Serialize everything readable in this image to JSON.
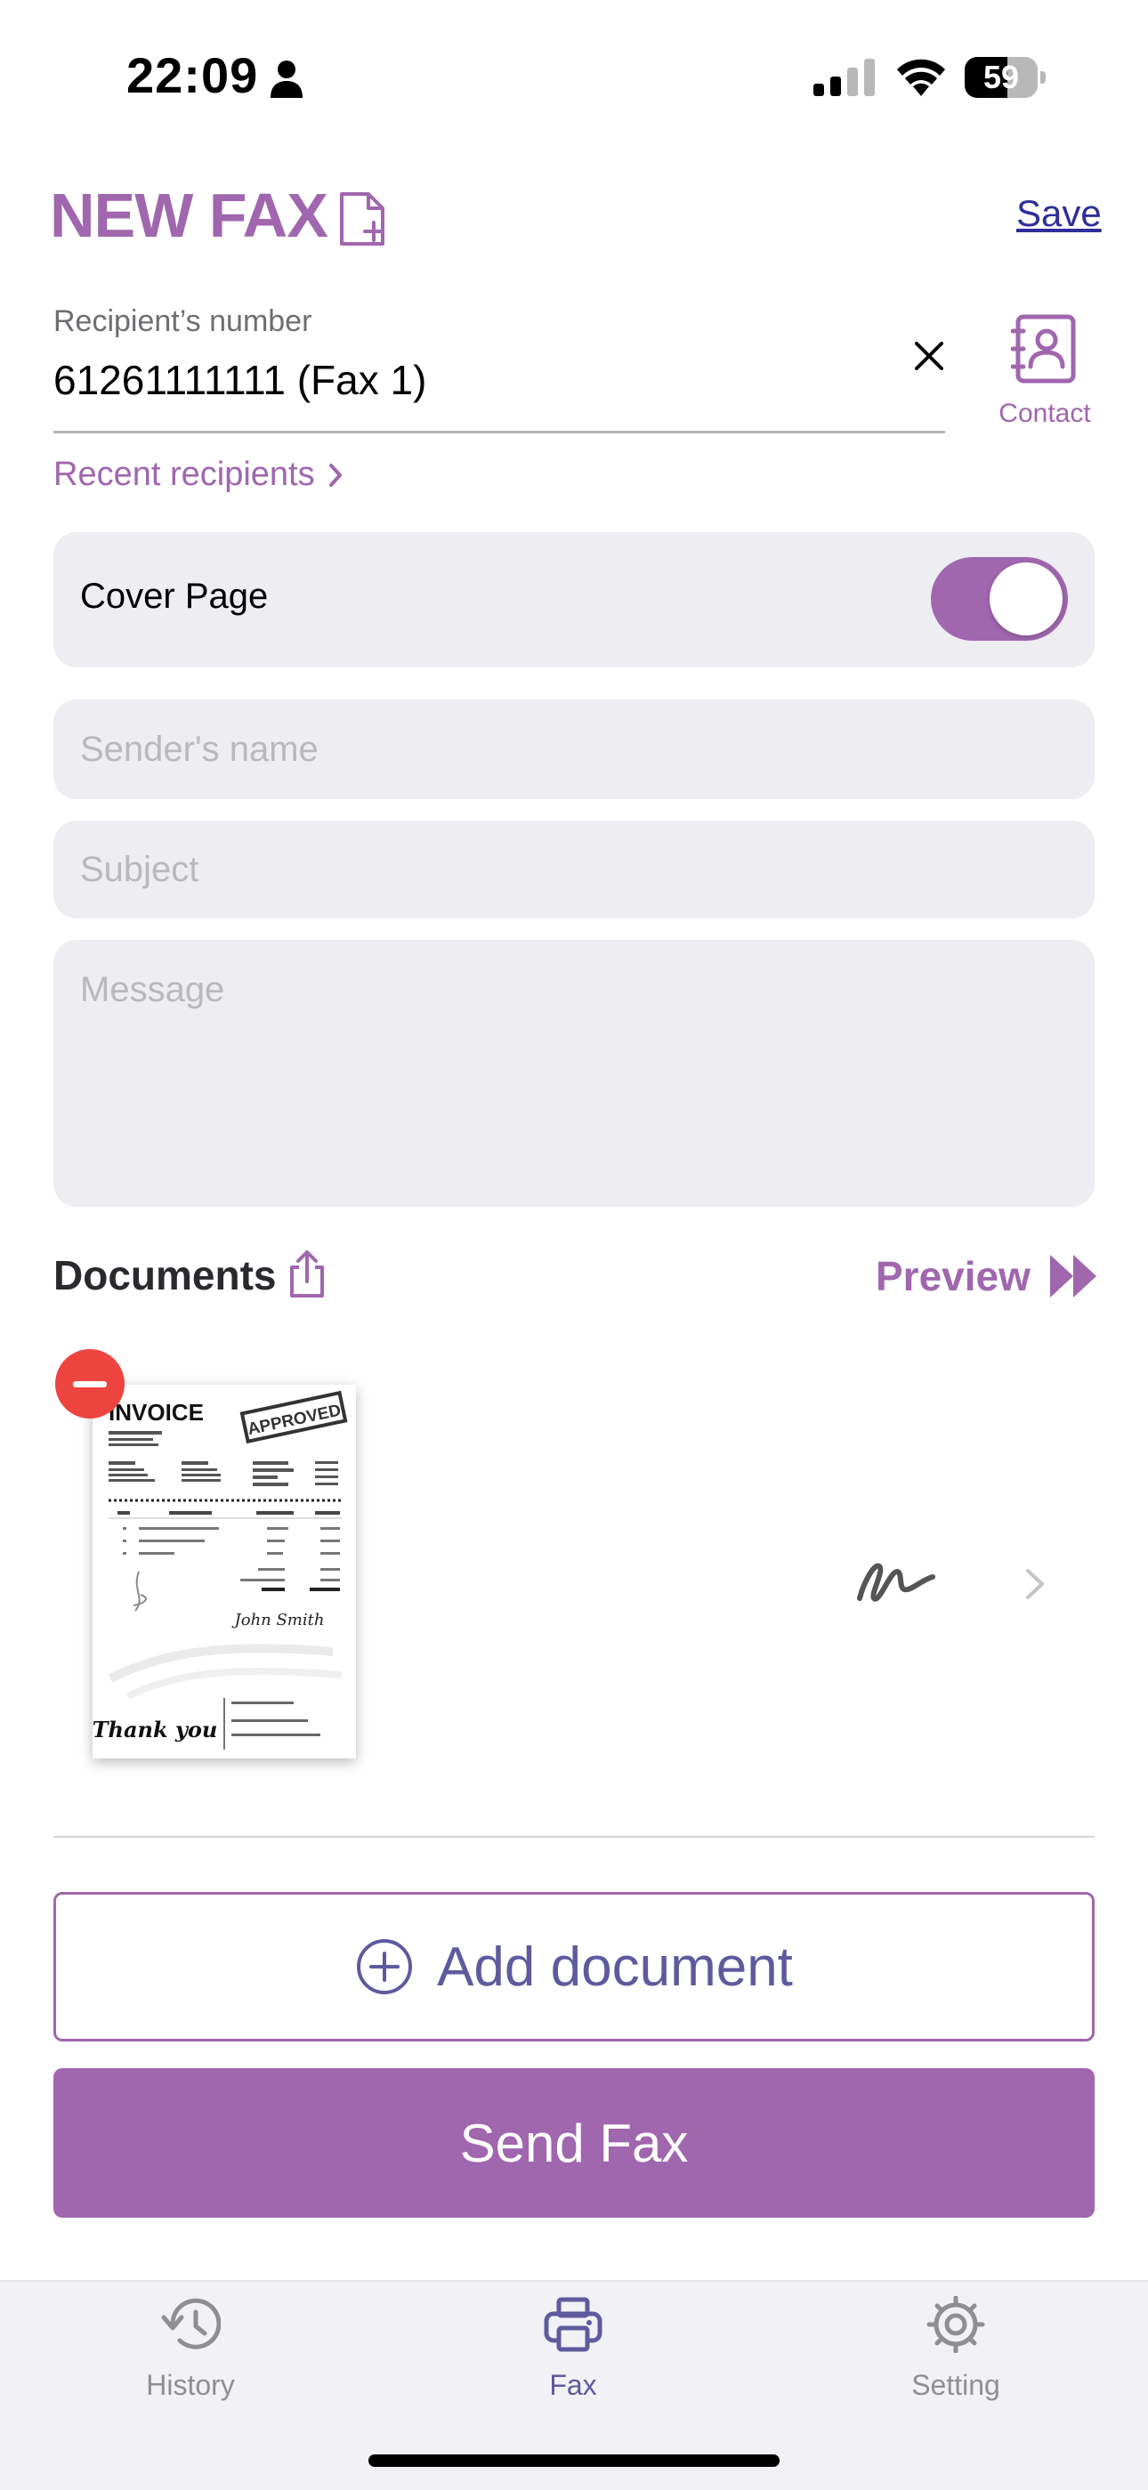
{
  "status_bar": {
    "time": "22:09",
    "battery_level": "59"
  },
  "header": {
    "title": "NEW FAX",
    "save_label": "Save"
  },
  "recipient": {
    "label": "Recipient’s number",
    "value": "61261111111 (Fax 1)",
    "contact_label": "Contact",
    "recent_label": "Recent recipients"
  },
  "cover_page": {
    "label": "Cover Page",
    "enabled": true
  },
  "fields": {
    "sender_placeholder": "Sender's name",
    "subject_placeholder": "Subject",
    "message_placeholder": "Message"
  },
  "documents": {
    "title": "Documents",
    "preview_label": "Preview",
    "items": [
      {
        "invoice_title": "INVOICE",
        "stamp": "APPROVED",
        "thank_you": "Thank you",
        "signature": "John Smith"
      }
    ]
  },
  "actions": {
    "add_document": "Add document",
    "send_fax": "Send Fax"
  },
  "tabs": [
    {
      "label": "History",
      "icon": "history-icon",
      "active": false
    },
    {
      "label": "Fax",
      "icon": "fax-icon",
      "active": true
    },
    {
      "label": "Setting",
      "icon": "gear-icon",
      "active": false
    }
  ],
  "colors": {
    "accent": "#a066ae",
    "navy": "#5f5a9e",
    "remove": "#ee4440"
  }
}
